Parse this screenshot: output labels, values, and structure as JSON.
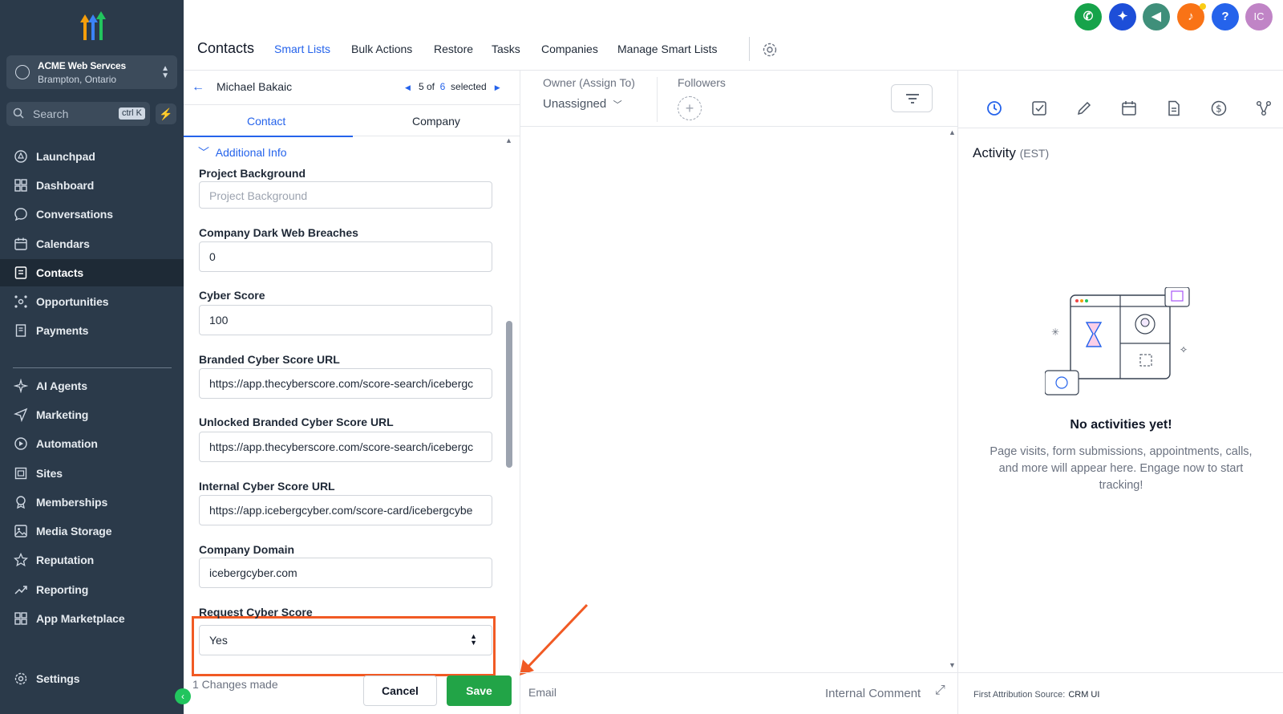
{
  "sidebar": {
    "account": {
      "name": "ACME Web Servces",
      "location": "Brampton, Ontario"
    },
    "search": {
      "placeholder": "Search",
      "shortcut": "ctrl K"
    },
    "items": [
      {
        "label": "Launchpad",
        "icon": "rocket-icon"
      },
      {
        "label": "Dashboard",
        "icon": "grid-icon"
      },
      {
        "label": "Conversations",
        "icon": "chat-icon"
      },
      {
        "label": "Calendars",
        "icon": "calendar-icon"
      },
      {
        "label": "Contacts",
        "icon": "contact-card-icon",
        "active": true
      },
      {
        "label": "Opportunities",
        "icon": "network-icon"
      },
      {
        "label": "Payments",
        "icon": "receipt-icon"
      }
    ],
    "items2": [
      {
        "label": "AI Agents",
        "icon": "sparkle-icon"
      },
      {
        "label": "Marketing",
        "icon": "send-icon"
      },
      {
        "label": "Automation",
        "icon": "automation-icon"
      },
      {
        "label": "Sites",
        "icon": "sites-icon"
      },
      {
        "label": "Memberships",
        "icon": "award-icon"
      },
      {
        "label": "Media Storage",
        "icon": "image-icon"
      },
      {
        "label": "Reputation",
        "icon": "star-icon"
      },
      {
        "label": "Reporting",
        "icon": "trend-icon"
      },
      {
        "label": "App Marketplace",
        "icon": "apps-icon"
      }
    ],
    "settings": "Settings"
  },
  "header": {
    "title": "Contacts",
    "tabs": [
      "Smart Lists",
      "Bulk Actions",
      "Restore",
      "Tasks",
      "Companies",
      "Manage Smart Lists"
    ],
    "avatar_initials": "IC"
  },
  "contact": {
    "name": "Michael Bakaic",
    "pager": {
      "current": "5",
      "of": "of",
      "total": "6",
      "suffix": "selected"
    },
    "subtabs": [
      "Contact",
      "Company"
    ],
    "section": "Additional Info",
    "fields": {
      "project_background": {
        "label": "Project Background",
        "placeholder": "Project Background"
      },
      "dark_web": {
        "label": "Company Dark Web Breaches",
        "value": "0"
      },
      "cyber_score": {
        "label": "Cyber Score",
        "value": "100"
      },
      "branded_url": {
        "label": "Branded Cyber Score URL",
        "value": "https://app.thecyberscore.com/score-search/icebergc"
      },
      "unlocked_url": {
        "label": "Unlocked Branded Cyber Score URL",
        "value": "https://app.thecyberscore.com/score-search/icebergc"
      },
      "internal_url": {
        "label": "Internal Cyber Score URL",
        "value": "https://app.icebergcyber.com/score-card/icebergcybe"
      },
      "domain": {
        "label": "Company Domain",
        "value": "icebergcyber.com"
      },
      "request": {
        "label": "Request Cyber Score",
        "value": "Yes"
      }
    },
    "changes": "1 Changes made",
    "cancel": "Cancel",
    "save": "Save"
  },
  "middle": {
    "owner_label": "Owner (Assign To)",
    "owner_value": "Unassigned",
    "followers_label": "Followers",
    "bottom_tabs": {
      "email": "Email",
      "internal": "Internal Comment"
    }
  },
  "activity": {
    "title": "Activity",
    "tz": "(EST)",
    "empty_title": "No activities yet!",
    "empty_desc": "Page visits, form submissions, appointments, calls, and more will appear here. Engage now to start tracking!",
    "attribution_label": "First Attribution Source:",
    "attribution_value": "CRM UI"
  },
  "colors": {
    "accent": "#2563eb",
    "save": "#22a447",
    "highlight": "#f15a24",
    "sidebar": "#2b3a4a"
  }
}
